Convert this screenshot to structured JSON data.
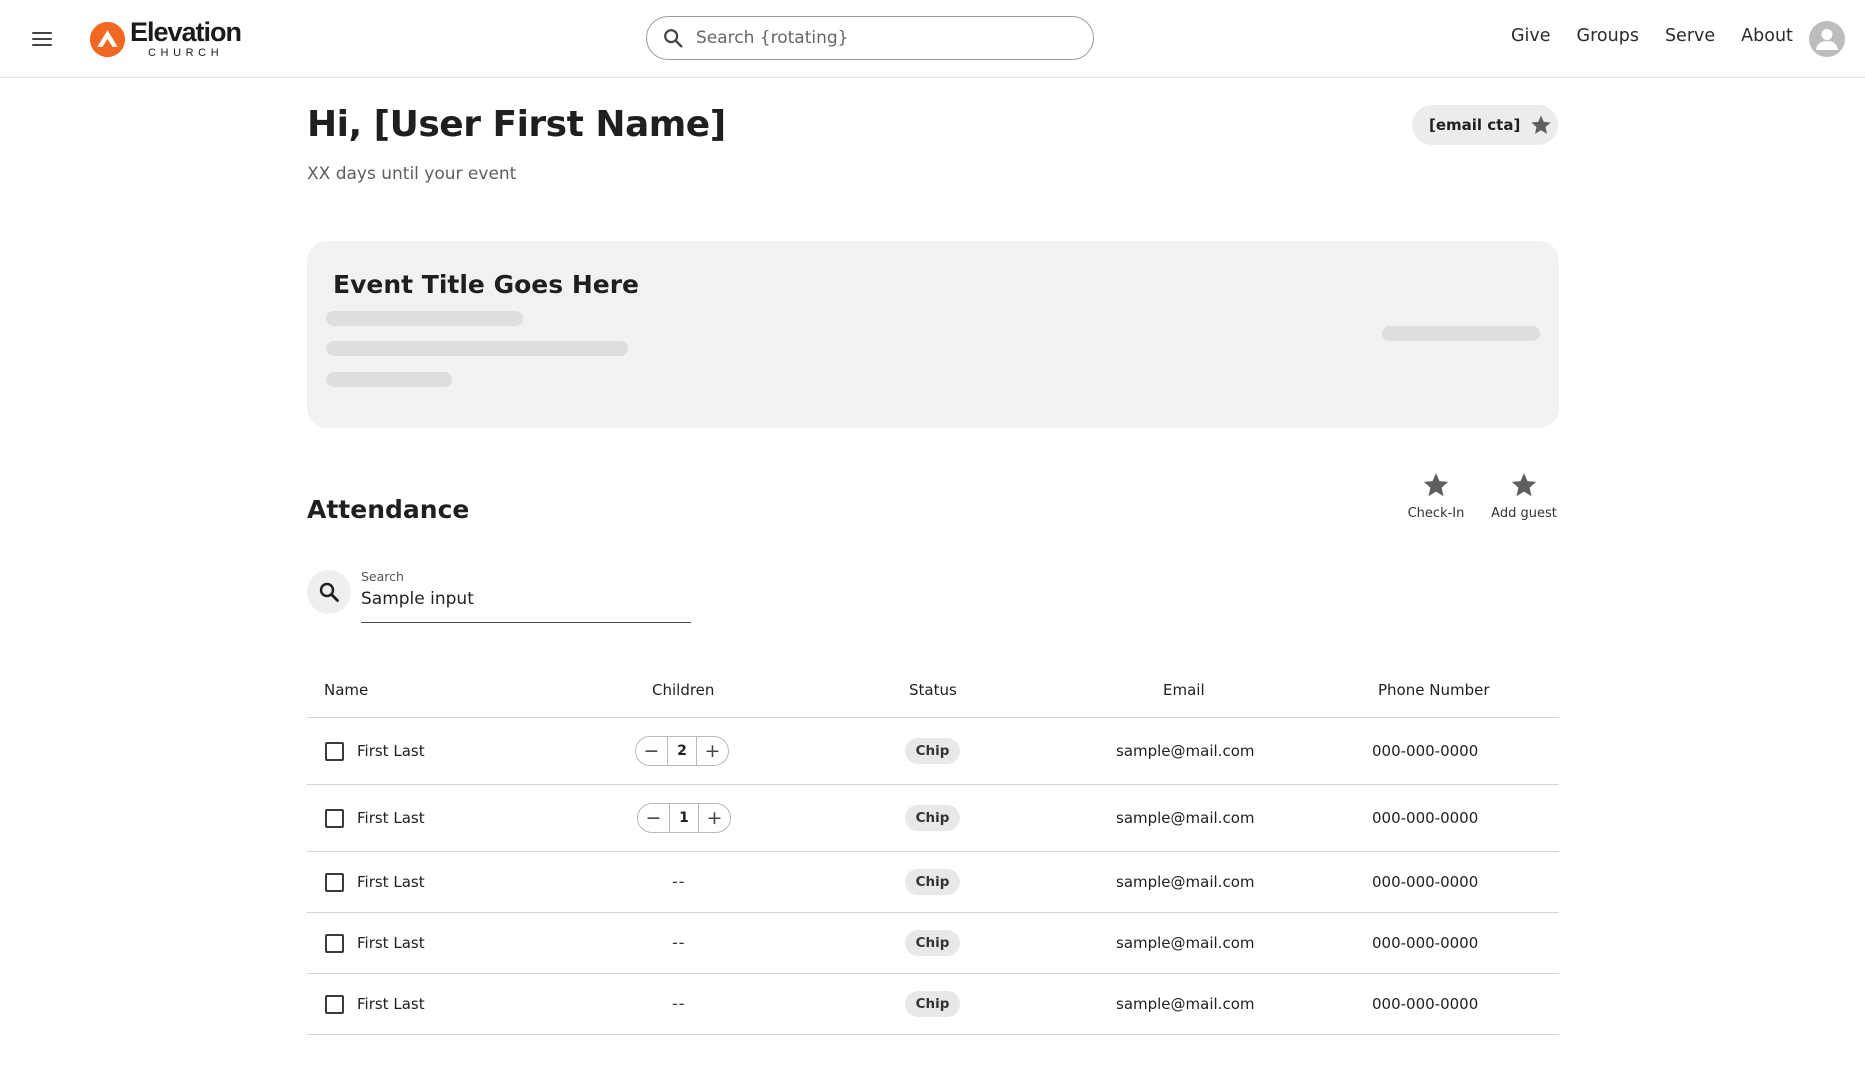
{
  "header": {
    "logo": {
      "name": "Elevation",
      "sub": "CHURCH",
      "brand_color": "#f26722"
    },
    "search_placeholder": "Search {rotating}",
    "nav": [
      "Give",
      "Groups",
      "Serve",
      "About"
    ]
  },
  "greeting": {
    "title": "Hi, [User First Name]",
    "subtitle": "XX days until your event",
    "email_cta": "[email cta]"
  },
  "event": {
    "title": "Event Title Goes Here"
  },
  "attendance": {
    "title": "Attendance",
    "actions": [
      "Check-In",
      "Add guest"
    ],
    "search": {
      "label": "Search",
      "value": "Sample input"
    },
    "columns": [
      "Name",
      "Children",
      "Status",
      "Email",
      "Phone Number"
    ],
    "rows": [
      {
        "name": "First Last",
        "children": "2",
        "status": "Chip",
        "email": "sample@mail.com",
        "phone": "000-000-0000"
      },
      {
        "name": "First Last",
        "children": "1",
        "status": "Chip",
        "email": "sample@mail.com",
        "phone": "000-000-0000"
      },
      {
        "name": "First Last",
        "children": "--",
        "status": "Chip",
        "email": "sample@mail.com",
        "phone": "000-000-0000"
      },
      {
        "name": "First Last",
        "children": "--",
        "status": "Chip",
        "email": "sample@mail.com",
        "phone": "000-000-0000"
      },
      {
        "name": "First Last",
        "children": "--",
        "status": "Chip",
        "email": "sample@mail.com",
        "phone": "000-000-0000"
      }
    ]
  }
}
